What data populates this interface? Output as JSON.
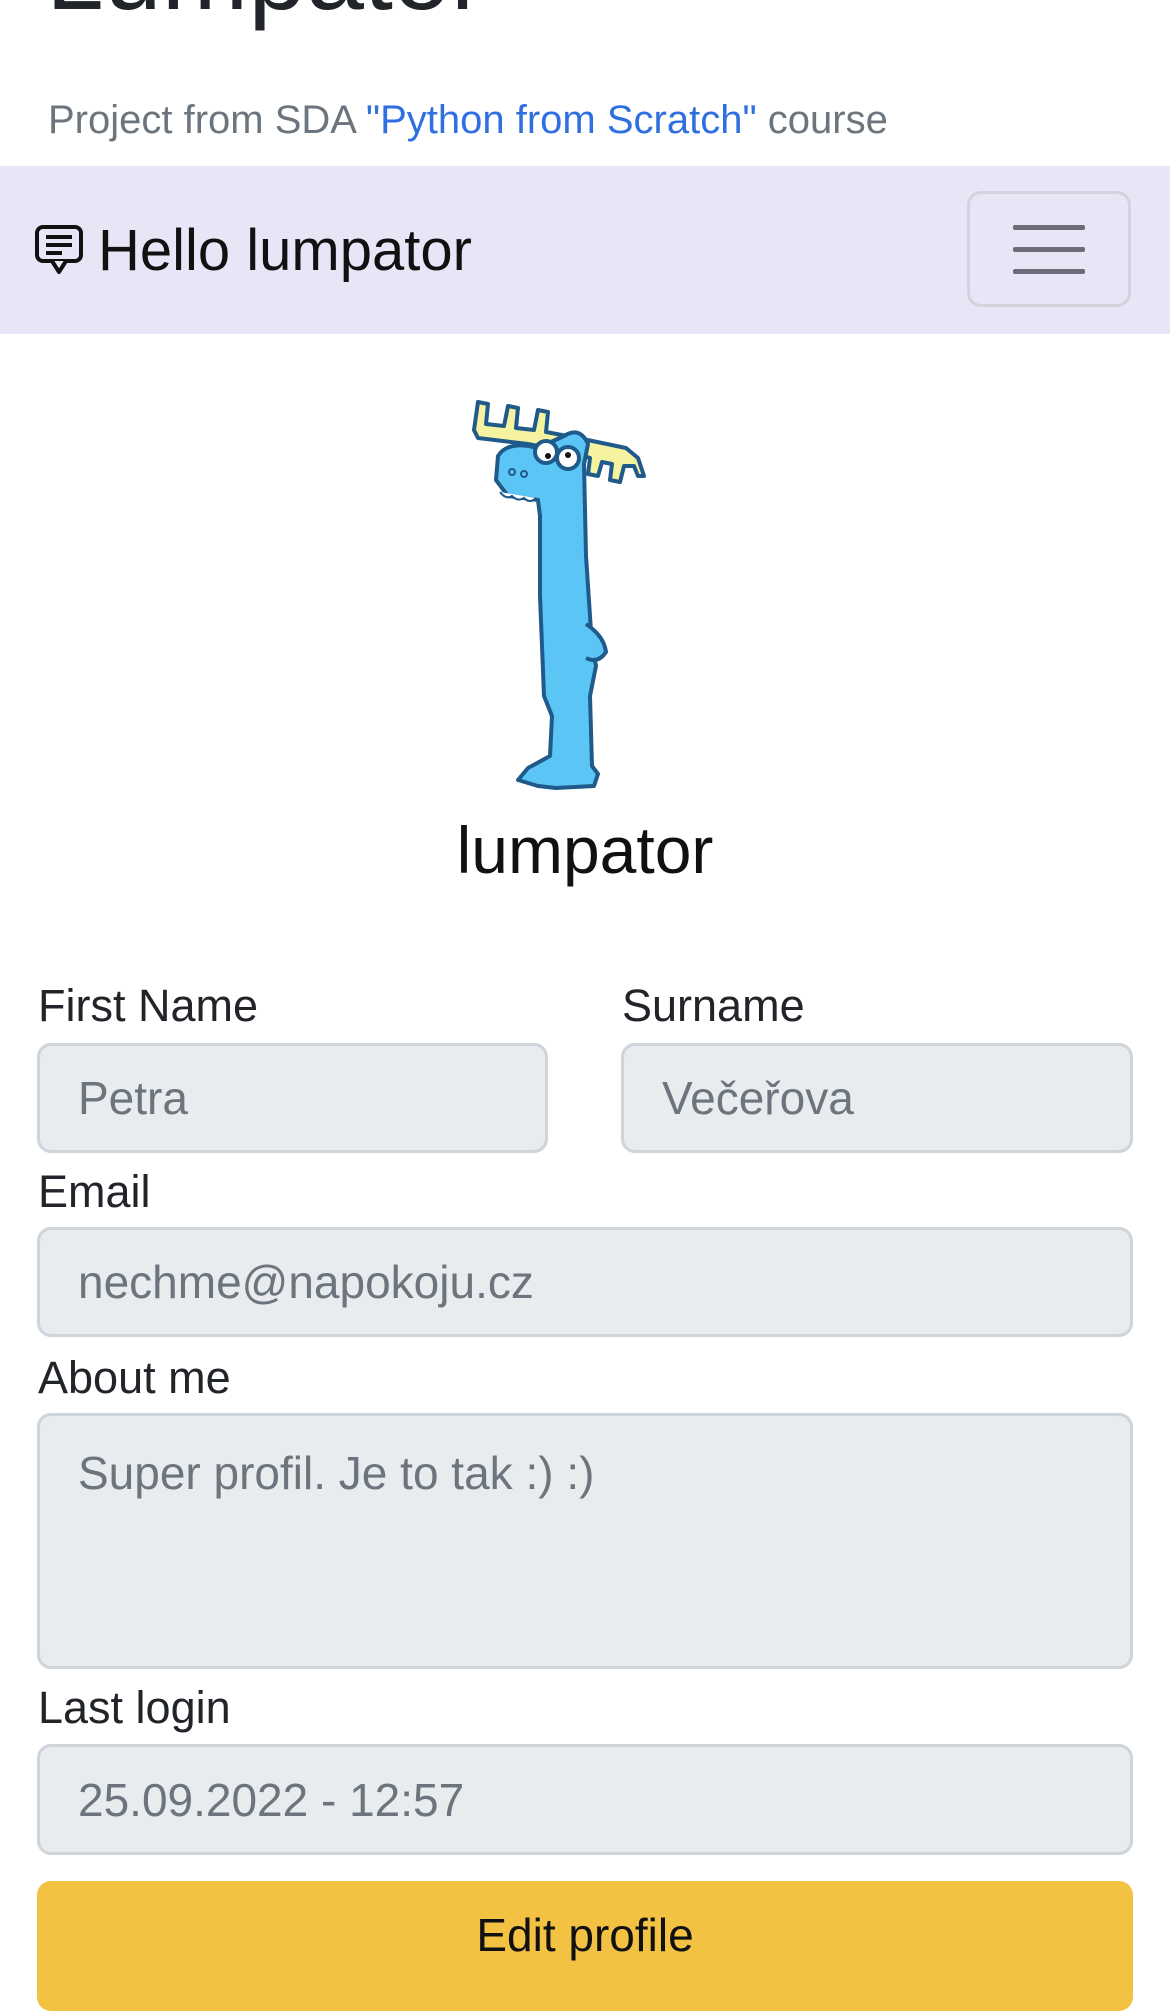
{
  "header": {
    "title": "Lumpator",
    "subtitle_prefix": "Project from SDA ",
    "subtitle_link": "\"Python from Scratch\"",
    "subtitle_suffix": " course",
    "link_color": "#2f6fe0"
  },
  "navbar": {
    "brand_icon": "chat-text-icon",
    "brand_label": "Hello lumpator",
    "toggler_icon": "hamburger-menu-icon",
    "background": "#e6e6f7"
  },
  "profile": {
    "avatar": "blue-moose-cartoon",
    "username": "lumpator",
    "fields": {
      "first_name": {
        "label": "First Name",
        "value": "Petra"
      },
      "surname": {
        "label": "Surname",
        "value": "Večeřova"
      },
      "email": {
        "label": "Email",
        "value": "nechme@napokoju.cz"
      },
      "about": {
        "label": "About me",
        "value": "Super profil. Je to tak :) :)"
      },
      "last_login": {
        "label": "Last login",
        "value": "25.09.2022 - 12:57"
      }
    },
    "edit_button": "Edit profile",
    "edit_button_color": "#f4c243"
  }
}
